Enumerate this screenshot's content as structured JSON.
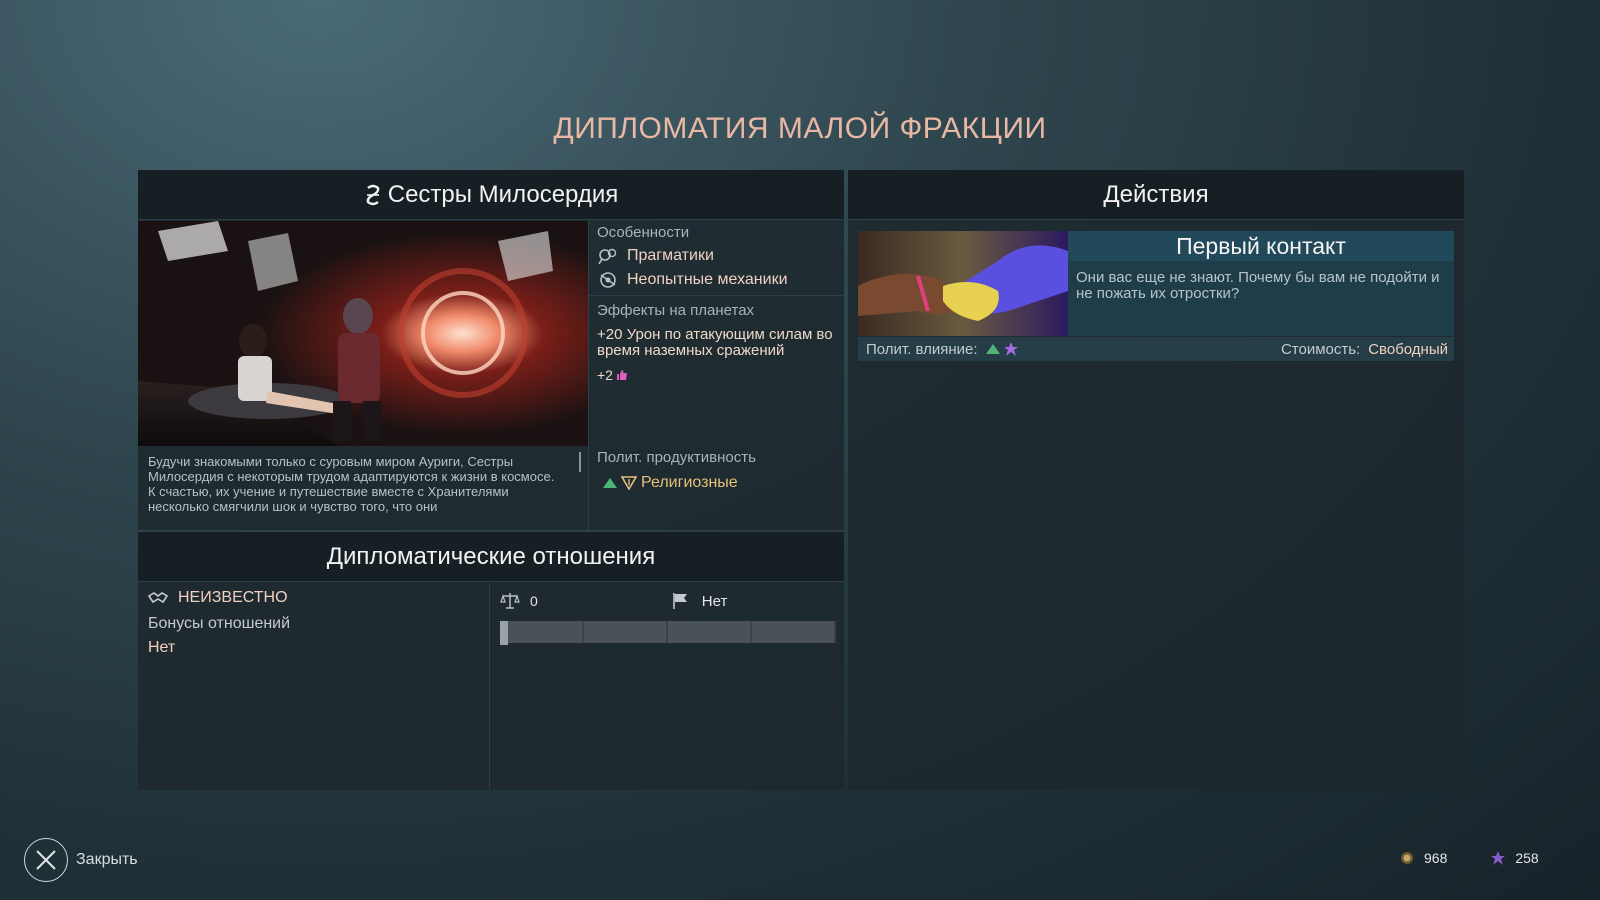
{
  "screen_title": "ДИПЛОМАТИЯ МАЛОЙ ФРАКЦИИ",
  "faction": {
    "name": "Сестры Милосердия",
    "icon": "faction-emblem-icon",
    "description": "Будучи знакомыми только с суровым миром Ауриги, Сестры Милосердия с некоторым трудом адаптируются к жизни в космосе. К счастью, их учение и путешествие вместе с Хранителями несколько смягчили шок и чувство того, что они",
    "traits_label": "Особенности",
    "traits": [
      {
        "label": "Прагматики",
        "icon": "pragmatic-icon"
      },
      {
        "label": "Неопытные механики",
        "icon": "mechanics-icon"
      }
    ],
    "planet_effects_label": "Эффекты на планетах",
    "planet_effect": "+20 Урон по атакующим силам во время наземных сражений",
    "planet_bonus": "+2",
    "planet_bonus_icon": "approval-icon",
    "political_label": "Полит. продуктивность",
    "political_value": "Религиозные",
    "colors": {
      "accent": "#e6c17a",
      "positive": "#4fb37a",
      "influence": "#a36be0"
    }
  },
  "diplomacy": {
    "header": "Дипломатические отношения",
    "status": "НЕИЗВЕСТНО",
    "status_icon": "handshake-icon",
    "bonuses_label": "Бонусы отношений",
    "bonuses_value": "Нет",
    "relation_score": "0",
    "relation_icon": "scales-icon",
    "treaty_label": "Нет",
    "treaty_icon": "flag-icon",
    "meter_fill": 0.0
  },
  "actions": {
    "header": "Действия",
    "items": [
      {
        "title": "Первый контакт",
        "description": "Они вас еще не знают. Почему бы вам не подойти и не пожать их отростки?",
        "influence_label": "Полит. влияние:",
        "cost_label": "Стоимость:",
        "cost_value": "Свободный"
      }
    ]
  },
  "footer": {
    "close_label": "Закрыть",
    "resources": [
      {
        "icon": "dust-icon",
        "value": "968",
        "color": "#c9a86a"
      },
      {
        "icon": "influence-star-icon",
        "value": "258",
        "color": "#8a5bd0"
      }
    ]
  }
}
